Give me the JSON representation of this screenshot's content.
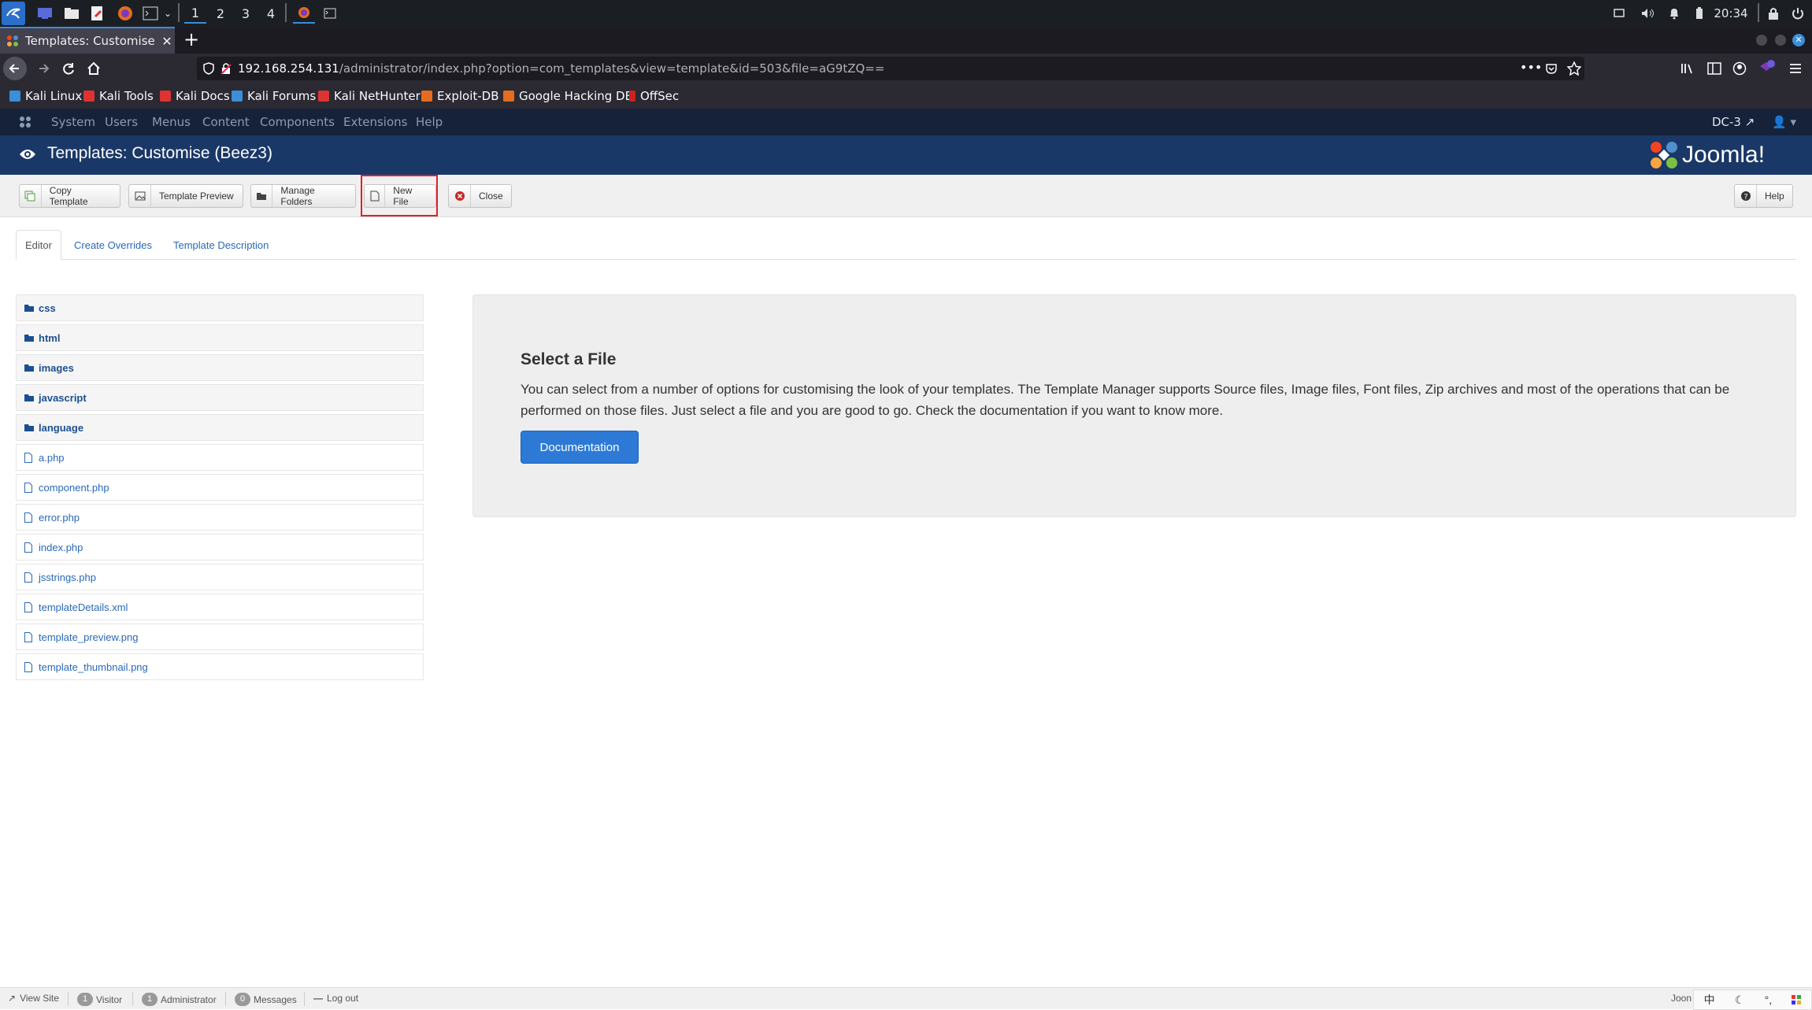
{
  "taskbar": {
    "workspaces": [
      "1",
      "2",
      "3",
      "4"
    ],
    "clock": "20:34"
  },
  "browser": {
    "tab_title": "Templates: Customise (B",
    "url_host": "192.168.254.131",
    "url_path": "/administrator/index.php?option=com_templates&view=template&id=503&file=aG9tZQ==",
    "new_tab_label": "+",
    "bookmarks": [
      "Kali Linux",
      "Kali Tools",
      "Kali Docs",
      "Kali Forums",
      "Kali NetHunter",
      "Exploit-DB",
      "Google Hacking DB",
      "OffSec"
    ]
  },
  "joomla_menu": {
    "items": [
      "System",
      "Users",
      "Menus",
      "Content",
      "Components",
      "Extensions",
      "Help"
    ],
    "site_name": "DC-3"
  },
  "header": {
    "title": "Templates: Customise (Beez3)",
    "logo_text": "Joomla!"
  },
  "toolbar": {
    "copy_template": "Copy Template",
    "template_preview": "Template Preview",
    "manage_folders": "Manage Folders",
    "new_file": "New File",
    "close": "Close",
    "help": "Help"
  },
  "tabs": [
    "Editor",
    "Create Overrides",
    "Template Description"
  ],
  "file_tree": {
    "folders": [
      "css",
      "html",
      "images",
      "javascript",
      "language"
    ],
    "files": [
      "a.php",
      "component.php",
      "error.php",
      "index.php",
      "jsstrings.php",
      "templateDetails.xml",
      "template_preview.png",
      "template_thumbnail.png"
    ]
  },
  "select_panel": {
    "heading": "Select a File",
    "body": "You can select from a number of options for customising the look of your templates. The Template Manager supports Source files, Image files, Font files, Zip archives and most of the operations that can be performed on those files. Just select a file and you are good to go. Check the documentation if you want to know more.",
    "button": "Documentation"
  },
  "statusbar": {
    "view_site": "View Site",
    "visitor_count": "1",
    "visitor_label": "Visitor",
    "admin_count": "1",
    "admin_label": "Administrator",
    "messages_count": "0",
    "messages_label": "Messages",
    "logout": "Log out",
    "right_text": "Joon",
    "ime_glyph": "中"
  },
  "colors": {
    "joomla_header": "#1a3867",
    "joomla_menu": "#15223a",
    "highlight_box": "#e0202c",
    "doc_button": "#2d7ad6"
  }
}
